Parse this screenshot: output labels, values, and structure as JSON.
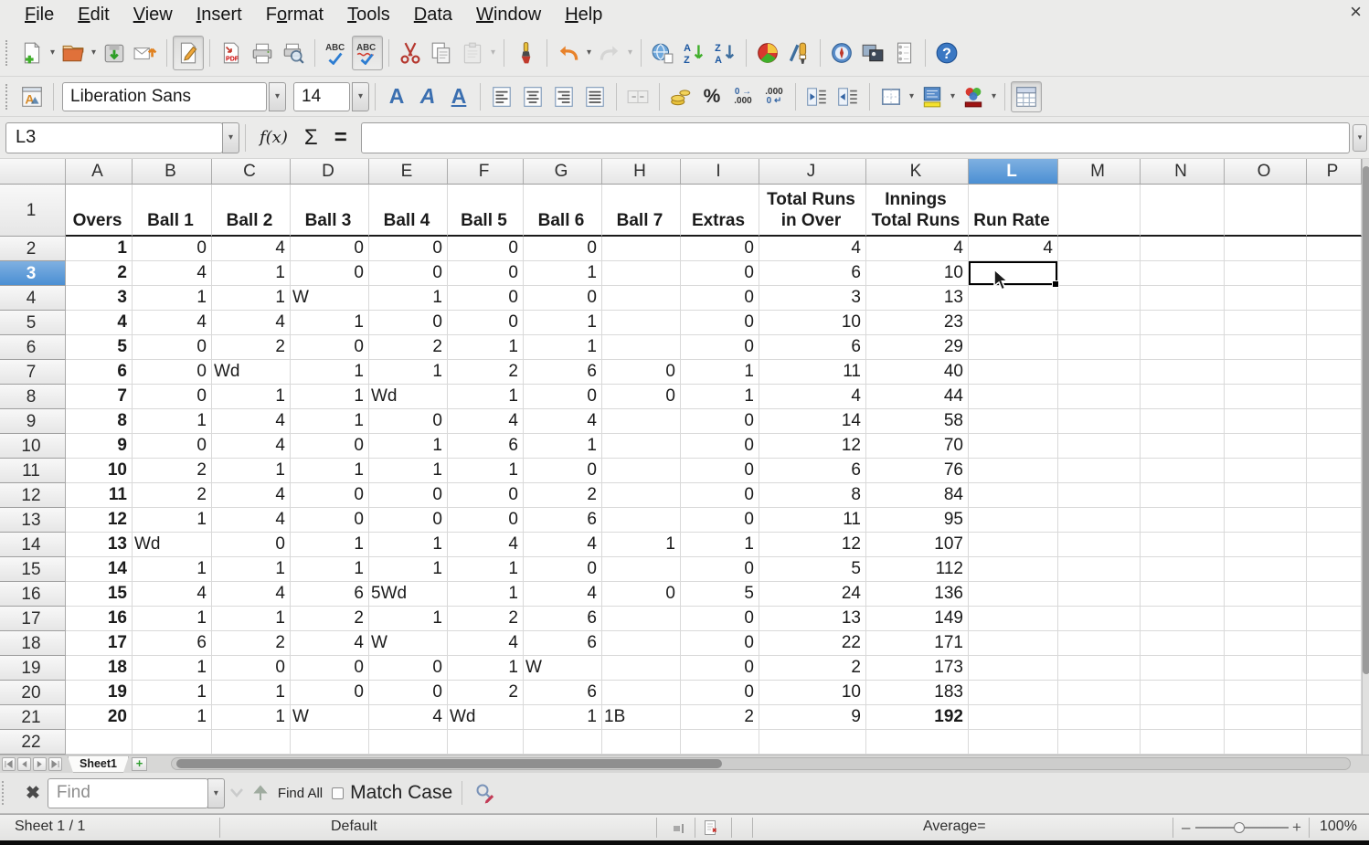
{
  "window": {
    "close_label": "×"
  },
  "menu_bar": {
    "items": [
      {
        "label": "File",
        "accel": 0
      },
      {
        "label": "Edit",
        "accel": 0
      },
      {
        "label": "View",
        "accel": 0
      },
      {
        "label": "Insert",
        "accel": 0
      },
      {
        "label": "Format",
        "accel": 1
      },
      {
        "label": "Tools",
        "accel": 0
      },
      {
        "label": "Data",
        "accel": 0
      },
      {
        "label": "Window",
        "accel": 0
      },
      {
        "label": "Help",
        "accel": 0
      }
    ]
  },
  "standard_toolbar": {
    "icons": [
      "new-document",
      "open",
      "save",
      "email",
      "edit-file",
      "export-pdf",
      "print",
      "print-preview",
      "spelling",
      "auto-spellcheck",
      "cut",
      "copy",
      "paste",
      "clone-formatting",
      "undo",
      "redo",
      "hyperlink",
      "sort-ascending",
      "sort-descending",
      "insert-chart",
      "draw-functions",
      "navigator",
      "gallery",
      "data-sources",
      "help"
    ]
  },
  "formatting_toolbar": {
    "font_name": "Liberation Sans",
    "font_size": "14",
    "icons": [
      "styles",
      "bold",
      "italic",
      "underline",
      "align-left",
      "align-center",
      "align-right",
      "justify",
      "merge-cells",
      "currency",
      "percent",
      "add-decimal",
      "delete-decimal",
      "decrease-indent",
      "increase-indent",
      "borders",
      "background-color",
      "font-color",
      "freeze-panes"
    ]
  },
  "glyphs": {
    "pdf": "PDF",
    "abc": "ABC",
    "question": "?",
    "sort_a": "A",
    "sort_z": "Z",
    "letter_a": "A",
    "percent": "%",
    "add_dec_top": "0 →",
    "add_dec_bottom": ".000",
    "del_dec_top": ".000",
    "del_dec_bottom": "0 ↵",
    "function": "f(x)",
    "sum": "Σ",
    "equals": "=",
    "caret": "▾",
    "find_close": "✖",
    "plus": "+",
    "zoom_minus": "–",
    "zoom_plus": "+"
  },
  "formula_bar": {
    "cell_reference": "L3",
    "input_value": ""
  },
  "grid": {
    "column_headers": [
      "A",
      "B",
      "C",
      "D",
      "E",
      "F",
      "G",
      "H",
      "I",
      "J",
      "K",
      "L",
      "M",
      "N",
      "O",
      "P"
    ],
    "col_widths": {
      "A": 73,
      "B": 87,
      "C": 86,
      "D": 86,
      "E": 86,
      "F": 83,
      "G": 86,
      "H": 86,
      "I": 86,
      "J": 117,
      "K": 112,
      "L": 98,
      "M": 90,
      "N": 92,
      "O": 90,
      "P": 60
    },
    "selected_column": "L",
    "selected_row": 3,
    "selected_cell": "L3",
    "header_cells": {
      "A": "Overs",
      "B": "Ball 1",
      "C": "Ball 2",
      "D": "Ball 3",
      "E": "Ball 4",
      "F": "Ball 5",
      "G": "Ball 6",
      "H": "Ball 7",
      "I": "Extras",
      "J": "Total Runs\nin Over",
      "K": "Innings\nTotal Runs",
      "L": "Run Rate"
    },
    "rows": [
      [
        "1",
        "0",
        "4",
        "0",
        "0",
        "0",
        "0",
        "",
        "0",
        "4",
        "4",
        "4"
      ],
      [
        "2",
        "4",
        "1",
        "0",
        "0",
        "0",
        "1",
        "",
        "0",
        "6",
        "10",
        ""
      ],
      [
        "3",
        "1",
        "1",
        "W",
        "1",
        "0",
        "0",
        "",
        "0",
        "3",
        "13",
        ""
      ],
      [
        "4",
        "4",
        "4",
        "1",
        "0",
        "0",
        "1",
        "",
        "0",
        "10",
        "23",
        ""
      ],
      [
        "5",
        "0",
        "2",
        "0",
        "2",
        "1",
        "1",
        "",
        "0",
        "6",
        "29",
        ""
      ],
      [
        "6",
        "0",
        "Wd",
        "1",
        "1",
        "2",
        "6",
        "0",
        "1",
        "11",
        "40",
        ""
      ],
      [
        "7",
        "0",
        "1",
        "1",
        "Wd",
        "1",
        "0",
        "0",
        "1",
        "4",
        "44",
        ""
      ],
      [
        "8",
        "1",
        "4",
        "1",
        "0",
        "4",
        "4",
        "",
        "0",
        "14",
        "58",
        ""
      ],
      [
        "9",
        "0",
        "4",
        "0",
        "1",
        "6",
        "1",
        "",
        "0",
        "12",
        "70",
        ""
      ],
      [
        "10",
        "2",
        "1",
        "1",
        "1",
        "1",
        "0",
        "",
        "0",
        "6",
        "76",
        ""
      ],
      [
        "11",
        "2",
        "4",
        "0",
        "0",
        "0",
        "2",
        "",
        "0",
        "8",
        "84",
        ""
      ],
      [
        "12",
        "1",
        "4",
        "0",
        "0",
        "0",
        "6",
        "",
        "0",
        "11",
        "95",
        ""
      ],
      [
        "13",
        "Wd",
        "0",
        "1",
        "1",
        "4",
        "4",
        "1",
        "1",
        "12",
        "107",
        ""
      ],
      [
        "14",
        "1",
        "1",
        "1",
        "1",
        "1",
        "0",
        "",
        "0",
        "5",
        "112",
        ""
      ],
      [
        "15",
        "4",
        "4",
        "6",
        "5Wd",
        "1",
        "4",
        "0",
        "5",
        "24",
        "136",
        ""
      ],
      [
        "16",
        "1",
        "1",
        "2",
        "1",
        "2",
        "6",
        "",
        "0",
        "13",
        "149",
        ""
      ],
      [
        "17",
        "6",
        "2",
        "4",
        "W",
        "4",
        "6",
        "",
        "0",
        "22",
        "171",
        ""
      ],
      [
        "18",
        "1",
        "0",
        "0",
        "0",
        "1",
        "W",
        "",
        "0",
        "2",
        "173",
        ""
      ],
      [
        "19",
        "1",
        "1",
        "0",
        "0",
        "2",
        "6",
        "",
        "0",
        "10",
        "183",
        ""
      ],
      [
        "20",
        "1",
        "1",
        "W",
        "4",
        "Wd",
        "1",
        "1B",
        "2",
        "9",
        "192",
        ""
      ]
    ],
    "bold_cells": [
      "K21"
    ],
    "last_row_number": 22
  },
  "sheet_tab_bar": {
    "tabs": [
      {
        "label": "Sheet1",
        "active": true
      }
    ]
  },
  "find_bar": {
    "placeholder": "Find",
    "find_all_label": "Find All",
    "match_case_label": "Match Case"
  },
  "status_bar": {
    "sheet_info": "Sheet 1 / 1",
    "page_style": "Default",
    "selection_info": "Average=",
    "zoom_level": "100%"
  }
}
